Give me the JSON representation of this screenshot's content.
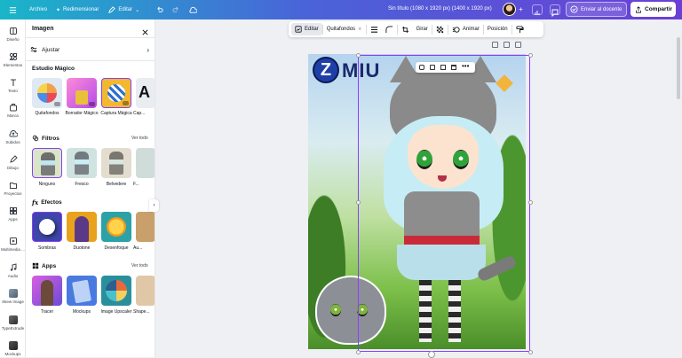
{
  "topbar": {
    "menu_icon": "hamburger-icon",
    "file_label": "Archivo",
    "resize_label": "Redimensionar",
    "edit_label": "Editar",
    "title": "Sin título (1080 x 1920 px) (1400 x 1920 px)",
    "send_label": "Enviar al docente",
    "share_label": "Compartir"
  },
  "rail": {
    "items": [
      {
        "label": "Diseño",
        "icon": "design-icon"
      },
      {
        "label": "Elementos",
        "icon": "elements-icon"
      },
      {
        "label": "Texto",
        "icon": "text-icon"
      },
      {
        "label": "Marca",
        "icon": "brand-icon"
      },
      {
        "label": "Subidos",
        "icon": "upload-icon"
      },
      {
        "label": "Dibujo",
        "icon": "draw-icon"
      },
      {
        "label": "Proyectos",
        "icon": "folder-icon"
      },
      {
        "label": "Apps",
        "icon": "apps-icon"
      },
      {
        "label": "Multimedia ...",
        "icon": "media-icon"
      },
      {
        "label": "Audio",
        "icon": "audio-icon"
      },
      {
        "label": "Skew Image",
        "icon": "skew-icon"
      },
      {
        "label": "TypeExtrude",
        "icon": "type-extrude-icon"
      },
      {
        "label": "Mockups",
        "icon": "mockups-icon"
      }
    ]
  },
  "panel": {
    "title": "Imagen",
    "adjust_label": "Ajustar",
    "magic_studio": {
      "title": "Estudio Mágico",
      "items": [
        {
          "label": "Quitafondos"
        },
        {
          "label": "Borrador Mágico"
        },
        {
          "label": "Captura Mágica"
        },
        {
          "label": "Cap..."
        }
      ]
    },
    "filters": {
      "title": "Filtros",
      "see_all": "Ver todo",
      "items": [
        {
          "label": "Ninguno"
        },
        {
          "label": "Fresco"
        },
        {
          "label": "Belvedere"
        },
        {
          "label": "F..."
        }
      ]
    },
    "effects": {
      "title": "Efectos",
      "items": [
        {
          "label": "Sombras"
        },
        {
          "label": "Duotone"
        },
        {
          "label": "Desenfoque"
        },
        {
          "label": "Au..."
        }
      ]
    },
    "apps": {
      "title": "Apps",
      "see_all": "Ver todo",
      "items": [
        {
          "label": "Tracer"
        },
        {
          "label": "Mockups"
        },
        {
          "label": "Image Upscaler"
        },
        {
          "label": "Shape..."
        }
      ]
    }
  },
  "context_toolbar": {
    "edit_label": "Editar",
    "bg_remover_label": "Quitafondos",
    "flip_label": "Girar",
    "animate_label": "Animar",
    "position_label": "Posición"
  },
  "canvas": {
    "logo_text": "MIU"
  }
}
